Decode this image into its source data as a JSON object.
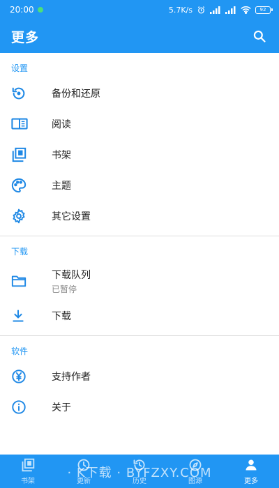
{
  "status_bar": {
    "time": "20:00",
    "network_speed": "5.7K/s",
    "battery": "92",
    "icons": [
      "notification-dot-icon",
      "alarm-icon",
      "signal-icon",
      "signal-icon",
      "wifi-icon",
      "battery-icon"
    ]
  },
  "app_bar": {
    "title": "更多",
    "search_icon": "search-icon"
  },
  "sections": {
    "settings": {
      "header": "设置",
      "items": [
        {
          "label": "备份和还原",
          "icon": "restore-icon"
        },
        {
          "label": "阅读",
          "icon": "book-open-icon"
        },
        {
          "label": "书架",
          "icon": "bookshelf-icon"
        },
        {
          "label": "主题",
          "icon": "palette-icon"
        },
        {
          "label": "其它设置",
          "icon": "gear-icon"
        }
      ]
    },
    "download": {
      "header": "下载",
      "items": [
        {
          "label": "下载队列",
          "sub": "已暂停",
          "icon": "folder-icon"
        },
        {
          "label": "下载",
          "icon": "download-icon"
        }
      ]
    },
    "software": {
      "header": "软件",
      "items": [
        {
          "label": "支持作者",
          "icon": "yen-icon"
        },
        {
          "label": "关于",
          "icon": "info-icon"
        }
      ]
    }
  },
  "bottom_nav": {
    "items": [
      {
        "label": "书架",
        "icon": "bookshelf-icon",
        "active": false
      },
      {
        "label": "更新",
        "icon": "update-icon",
        "active": false
      },
      {
        "label": "历史",
        "icon": "history-icon",
        "active": false
      },
      {
        "label": "图源",
        "icon": "compass-icon",
        "active": false
      },
      {
        "label": "更多",
        "icon": "person-icon",
        "active": true
      }
    ]
  },
  "watermark": "· K下载 · BYFZXY.COM",
  "colors": {
    "primary": "#2196f3",
    "section_header": "#2196f3",
    "text": "#212121",
    "subtext": "#888888",
    "divider": "#dddddd"
  }
}
